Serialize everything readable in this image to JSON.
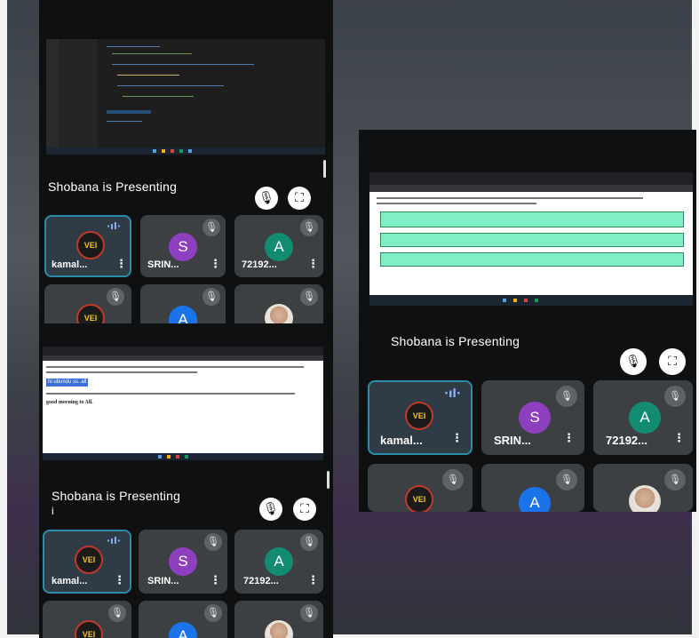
{
  "presenter_label": "Shobana is Presenting",
  "presenter_label_suffix": "i",
  "icons": {
    "mic_off": "mic-off-icon",
    "fullscreen": "fullscreen-icon",
    "mic_off_glyph": "🎙",
    "fullscreen_glyph": "⛶",
    "menu_glyph": "⋮",
    "speaking_glyph": "·ıl·"
  },
  "participants": [
    {
      "name": "kamal...",
      "avatar_text": "VEI",
      "avatar_type": "logo",
      "speaking": true
    },
    {
      "name": "SRIN...",
      "avatar_text": "S",
      "avatar_color": "#8e3fbf",
      "avatar_type": "letter"
    },
    {
      "name": "72192...",
      "avatar_text": "A",
      "avatar_color": "#138a72",
      "avatar_type": "letter"
    },
    {
      "name": "",
      "avatar_text": "VEI",
      "avatar_type": "logo"
    },
    {
      "name": "",
      "avatar_text": "A",
      "avatar_color": "#1a73e8",
      "avatar_type": "letter"
    },
    {
      "name": "",
      "avatar_text": "",
      "avatar_type": "photo"
    }
  ],
  "shared_doc": {
    "highlight_text": "hi ubundu ss..all",
    "body_line": "good morning to All."
  },
  "colors": {
    "active_border": "#2a8ca8",
    "note_green": "#7ff0c6",
    "tile_bg": "#3c4043"
  }
}
